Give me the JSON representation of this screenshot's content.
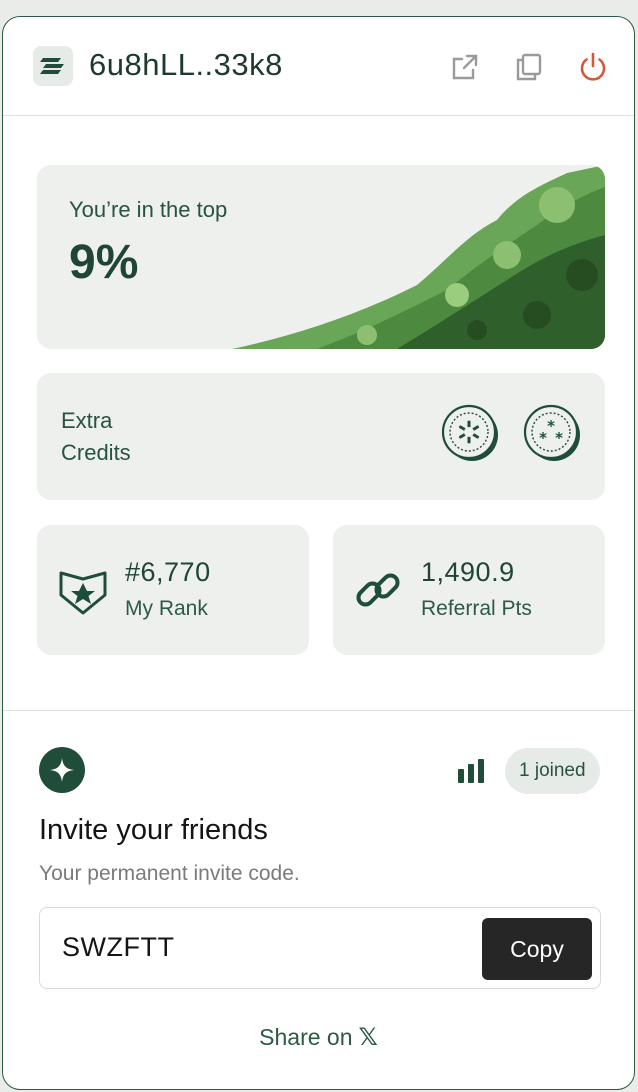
{
  "header": {
    "address": "6u8hLL..33k8",
    "icons": [
      "logo-icon",
      "external-link-icon",
      "copy-icon",
      "power-icon"
    ],
    "power_color": "#d4583a"
  },
  "top_card": {
    "label": "You’re in the top",
    "percent": "9%"
  },
  "credits": {
    "label_line1": "Extra",
    "label_line2": "Credits",
    "coins": [
      "asterisk-coin-icon",
      "triple-asterisk-coin-icon"
    ]
  },
  "stats": {
    "rank": {
      "value": "#6,770",
      "label": "My Rank",
      "icon": "star-shield-icon"
    },
    "referral": {
      "value": "1,490.9",
      "label": "Referral Pts",
      "icon": "chain-link-icon"
    }
  },
  "invite": {
    "joined": "1 joined",
    "title": "Invite your friends",
    "subtitle": "Your permanent invite code.",
    "code": "SWZFTT",
    "copy_label": "Copy",
    "share_label": "Share on",
    "share_glyph": "𝕏"
  },
  "colors": {
    "brand": "#1f4d3a",
    "card_bg": "#eef0ee",
    "button_dark": "#262626"
  }
}
